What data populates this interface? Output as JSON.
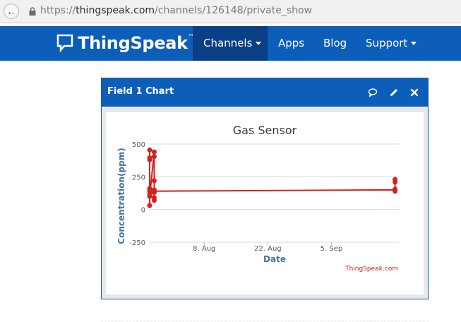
{
  "browser": {
    "url_scheme": "https://",
    "url_host": "thingspeak.com",
    "url_path": "/channels/126148/private_show"
  },
  "navbar": {
    "brand": "ThingSpeak",
    "brand_tm": "™",
    "items": [
      {
        "label": "Channels",
        "dropdown": true,
        "active": true
      },
      {
        "label": "Apps",
        "dropdown": false,
        "active": false
      },
      {
        "label": "Blog",
        "dropdown": false,
        "active": false
      },
      {
        "label": "Support",
        "dropdown": true,
        "active": false
      }
    ],
    "color": "#0c5eb9",
    "active_color": "#093f85"
  },
  "panel": {
    "title": "Field 1 Chart",
    "icons": [
      "comment-icon",
      "pencil-icon",
      "close-icon"
    ]
  },
  "chart_data": {
    "type": "line",
    "title": "Gas Sensor",
    "xlabel": "Date",
    "ylabel": "Concentration(ppm)",
    "credit": "ThingSpeak.com",
    "ylim": [
      -250,
      500
    ],
    "yticks": [
      500,
      250,
      0,
      -250
    ],
    "xticks": [
      "8. Aug",
      "22. Aug",
      "5. Sep"
    ],
    "xtick_dates": [
      "2016-08-08",
      "2016-08-22",
      "2016-09-05"
    ],
    "xlim": [
      "2016-07-27",
      "2016-09-20"
    ],
    "grid": true,
    "line_color": "#d62020",
    "series": [
      {
        "points": [
          {
            "x": "2016-07-27",
            "y": 140
          },
          {
            "x": "2016-07-27",
            "y": 455
          },
          {
            "x": "2016-07-27",
            "y": 395
          },
          {
            "x": "2016-07-27",
            "y": 380
          },
          {
            "x": "2016-07-27",
            "y": 30
          },
          {
            "x": "2016-07-27",
            "y": 120
          },
          {
            "x": "2016-07-27",
            "y": 160
          },
          {
            "x": "2016-07-27",
            "y": 100
          },
          {
            "x": "2016-07-28",
            "y": 440
          },
          {
            "x": "2016-07-28",
            "y": 405
          },
          {
            "x": "2016-07-28",
            "y": 70
          },
          {
            "x": "2016-07-28",
            "y": 130
          },
          {
            "x": "2016-07-28",
            "y": 220
          },
          {
            "x": "2016-07-28",
            "y": 150
          },
          {
            "x": "2016-07-28",
            "y": 90
          },
          {
            "x": "2016-07-28",
            "y": 140
          },
          {
            "x": "2016-09-19",
            "y": 150
          },
          {
            "x": "2016-09-19",
            "y": 230
          },
          {
            "x": "2016-09-19",
            "y": 210
          },
          {
            "x": "2016-09-19",
            "y": 140
          },
          {
            "x": "2016-09-19",
            "y": 155
          }
        ]
      }
    ]
  }
}
